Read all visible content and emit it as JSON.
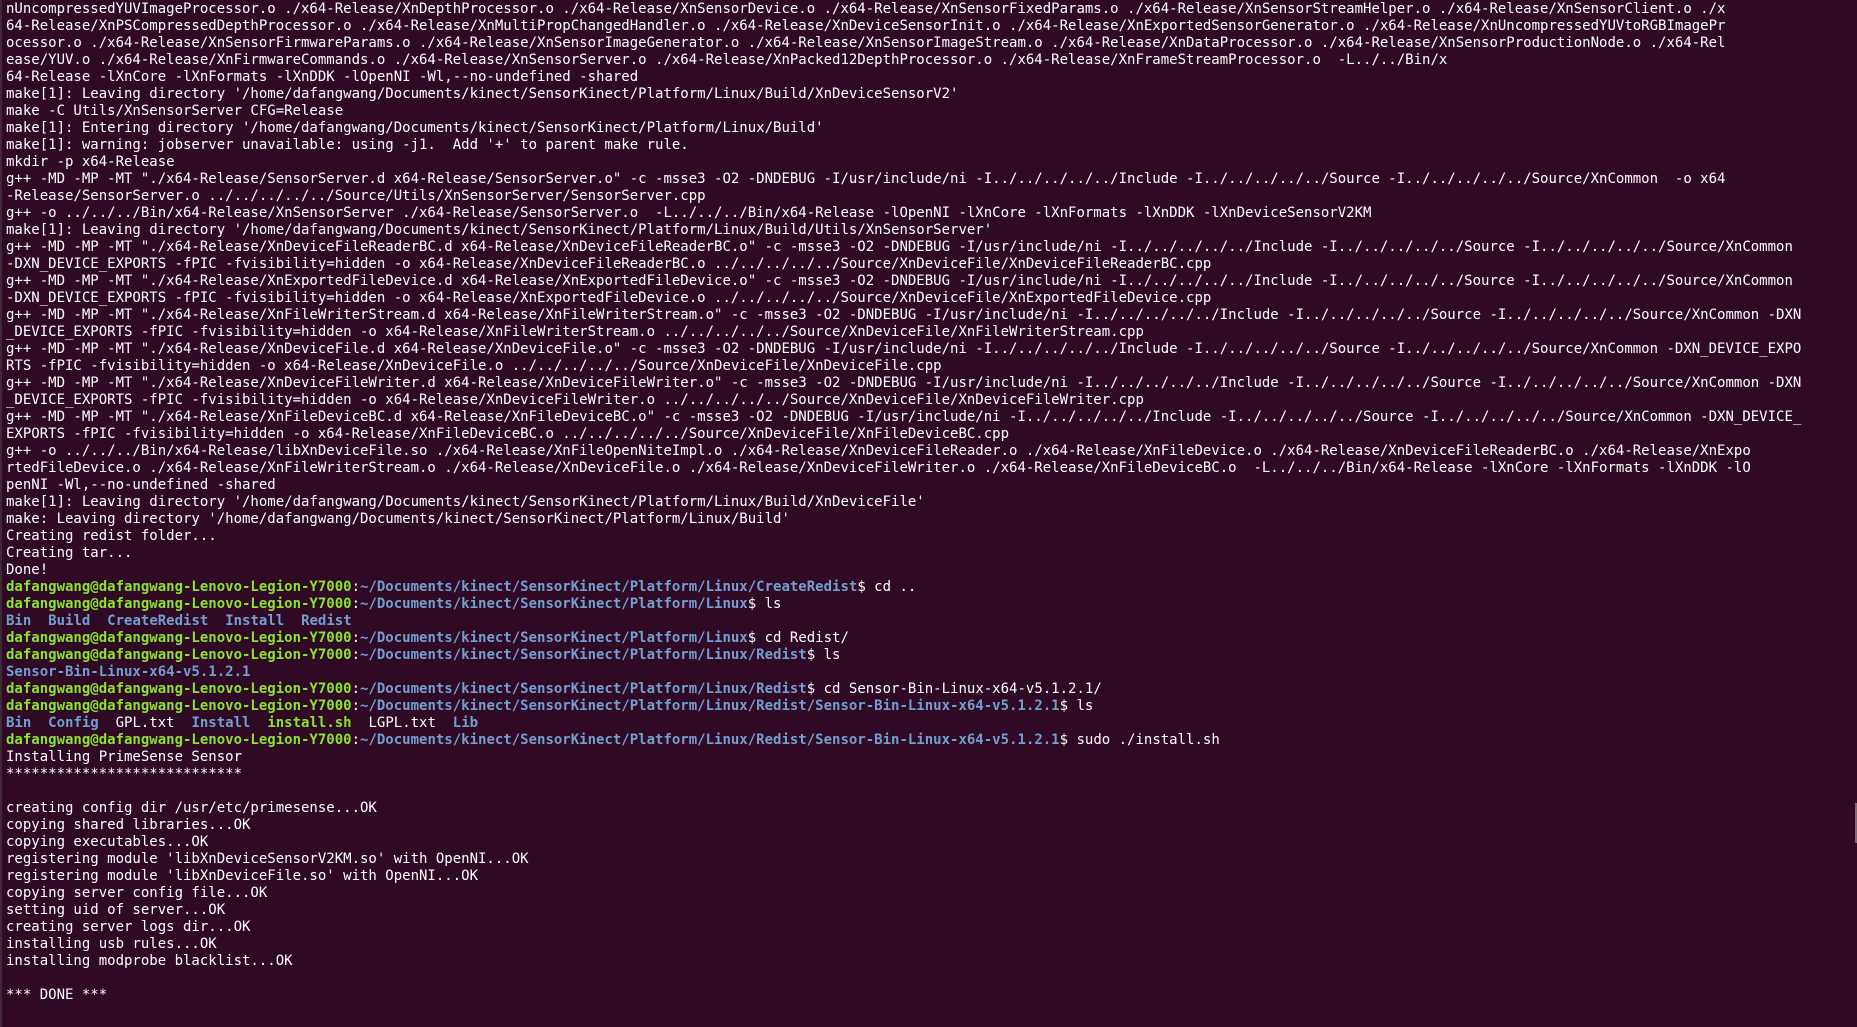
{
  "colors": {
    "background": "#300a24",
    "text": "#ffffff",
    "prompt_user": "#8ae234",
    "prompt_path": "#729fcf",
    "directory": "#729fcf",
    "executable": "#8ae234"
  },
  "terminal": {
    "lines": [
      [
        {
          "t": "plain",
          "text": "nUncompressedYUVImageProcessor.o ./x64-Release/XnDepthProcessor.o ./x64-Release/XnSensorDevice.o ./x64-Release/XnSensorFixedParams.o ./x64-Release/XnSensorStreamHelper.o ./x64-Release/XnSensorClient.o ./x"
        }
      ],
      [
        {
          "t": "plain",
          "text": "64-Release/XnPSCompressedDepthProcessor.o ./x64-Release/XnMultiPropChangedHandler.o ./x64-Release/XnDeviceSensorInit.o ./x64-Release/XnExportedSensorGenerator.o ./x64-Release/XnUncompressedYUVtoRGBImagePr"
        }
      ],
      [
        {
          "t": "plain",
          "text": "ocessor.o ./x64-Release/XnSensorFirmwareParams.o ./x64-Release/XnSensorImageGenerator.o ./x64-Release/XnSensorImageStream.o ./x64-Release/XnDataProcessor.o ./x64-Release/XnSensorProductionNode.o ./x64-Rel"
        }
      ],
      [
        {
          "t": "plain",
          "text": "ease/YUV.o ./x64-Release/XnFirmwareCommands.o ./x64-Release/XnSensorServer.o ./x64-Release/XnPacked12DepthProcessor.o ./x64-Release/XnFrameStreamProcessor.o  -L../../Bin/x"
        }
      ],
      [
        {
          "t": "plain",
          "text": "64-Release -lXnCore -lXnFormats -lXnDDK -lOpenNI -Wl,--no-undefined -shared"
        }
      ],
      [
        {
          "t": "plain",
          "text": "make[1]: Leaving directory '/home/dafangwang/Documents/kinect/SensorKinect/Platform/Linux/Build/XnDeviceSensorV2'"
        }
      ],
      [
        {
          "t": "plain",
          "text": "make -C Utils/XnSensorServer CFG=Release"
        }
      ],
      [
        {
          "t": "plain",
          "text": "make[1]: Entering directory '/home/dafangwang/Documents/kinect/SensorKinect/Platform/Linux/Build'"
        }
      ],
      [
        {
          "t": "plain",
          "text": "make[1]: warning: jobserver unavailable: using -j1.  Add '+' to parent make rule."
        }
      ],
      [
        {
          "t": "plain",
          "text": "mkdir -p x64-Release"
        }
      ],
      [
        {
          "t": "plain",
          "text": "g++ -MD -MP -MT \"./x64-Release/SensorServer.d x64-Release/SensorServer.o\" -c -msse3 -O2 -DNDEBUG -I/usr/include/ni -I../../../../../Include -I../../../../../Source -I../../../../../Source/XnCommon  -o x64"
        }
      ],
      [
        {
          "t": "plain",
          "text": "-Release/SensorServer.o ../../../../../Source/Utils/XnSensorServer/SensorServer.cpp"
        }
      ],
      [
        {
          "t": "plain",
          "text": "g++ -o ../../../Bin/x64-Release/XnSensorServer ./x64-Release/SensorServer.o  -L../../../Bin/x64-Release -lOpenNI -lXnCore -lXnFormats -lXnDDK -lXnDeviceSensorV2KM"
        }
      ],
      [
        {
          "t": "plain",
          "text": "make[1]: Leaving directory '/home/dafangwang/Documents/kinect/SensorKinect/Platform/Linux/Build/Utils/XnSensorServer'"
        }
      ],
      [
        {
          "t": "plain",
          "text": "g++ -MD -MP -MT \"./x64-Release/XnDeviceFileReaderBC.d x64-Release/XnDeviceFileReaderBC.o\" -c -msse3 -O2 -DNDEBUG -I/usr/include/ni -I../../../../../Include -I../../../../../Source -I../../../../../Source/XnCommon"
        }
      ],
      [
        {
          "t": "plain",
          "text": "-DXN_DEVICE_EXPORTS -fPIC -fvisibility=hidden -o x64-Release/XnDeviceFileReaderBC.o ../../../../../Source/XnDeviceFile/XnDeviceFileReaderBC.cpp"
        }
      ],
      [
        {
          "t": "plain",
          "text": "g++ -MD -MP -MT \"./x64-Release/XnExportedFileDevice.d x64-Release/XnExportedFileDevice.o\" -c -msse3 -O2 -DNDEBUG -I/usr/include/ni -I../../../../../Include -I../../../../../Source -I../../../../../Source/XnCommon"
        }
      ],
      [
        {
          "t": "plain",
          "text": "-DXN_DEVICE_EXPORTS -fPIC -fvisibility=hidden -o x64-Release/XnExportedFileDevice.o ../../../../../Source/XnDeviceFile/XnExportedFileDevice.cpp"
        }
      ],
      [
        {
          "t": "plain",
          "text": "g++ -MD -MP -MT \"./x64-Release/XnFileWriterStream.d x64-Release/XnFileWriterStream.o\" -c -msse3 -O2 -DNDEBUG -I/usr/include/ni -I../../../../../Include -I../../../../../Source -I../../../../../Source/XnCommon -DXN"
        }
      ],
      [
        {
          "t": "plain",
          "text": "_DEVICE_EXPORTS -fPIC -fvisibility=hidden -o x64-Release/XnFileWriterStream.o ../../../../../Source/XnDeviceFile/XnFileWriterStream.cpp"
        }
      ],
      [
        {
          "t": "plain",
          "text": "g++ -MD -MP -MT \"./x64-Release/XnDeviceFile.d x64-Release/XnDeviceFile.o\" -c -msse3 -O2 -DNDEBUG -I/usr/include/ni -I../../../../../Include -I../../../../../Source -I../../../../../Source/XnCommon -DXN_DEVICE_EXPO"
        }
      ],
      [
        {
          "t": "plain",
          "text": "RTS -fPIC -fvisibility=hidden -o x64-Release/XnDeviceFile.o ../../../../../Source/XnDeviceFile/XnDeviceFile.cpp"
        }
      ],
      [
        {
          "t": "plain",
          "text": "g++ -MD -MP -MT \"./x64-Release/XnDeviceFileWriter.d x64-Release/XnDeviceFileWriter.o\" -c -msse3 -O2 -DNDEBUG -I/usr/include/ni -I../../../../../Include -I../../../../../Source -I../../../../../Source/XnCommon -DXN"
        }
      ],
      [
        {
          "t": "plain",
          "text": "_DEVICE_EXPORTS -fPIC -fvisibility=hidden -o x64-Release/XnDeviceFileWriter.o ../../../../../Source/XnDeviceFile/XnDeviceFileWriter.cpp"
        }
      ],
      [
        {
          "t": "plain",
          "text": "g++ -MD -MP -MT \"./x64-Release/XnFileDeviceBC.d x64-Release/XnFileDeviceBC.o\" -c -msse3 -O2 -DNDEBUG -I/usr/include/ni -I../../../../../Include -I../../../../../Source -I../../../../../Source/XnCommon -DXN_DEVICE_"
        }
      ],
      [
        {
          "t": "plain",
          "text": "EXPORTS -fPIC -fvisibility=hidden -o x64-Release/XnFileDeviceBC.o ../../../../../Source/XnDeviceFile/XnFileDeviceBC.cpp"
        }
      ],
      [
        {
          "t": "plain",
          "text": "g++ -o ../../../Bin/x64-Release/libXnDeviceFile.so ./x64-Release/XnFileOpenNiteImpl.o ./x64-Release/XnDeviceFileReader.o ./x64-Release/XnFileDevice.o ./x64-Release/XnDeviceFileReaderBC.o ./x64-Release/XnExpo"
        }
      ],
      [
        {
          "t": "plain",
          "text": "rtedFileDevice.o ./x64-Release/XnFileWriterStream.o ./x64-Release/XnDeviceFile.o ./x64-Release/XnDeviceFileWriter.o ./x64-Release/XnFileDeviceBC.o  -L../../../Bin/x64-Release -lXnCore -lXnFormats -lXnDDK -lO"
        }
      ],
      [
        {
          "t": "plain",
          "text": "penNI -Wl,--no-undefined -shared"
        }
      ],
      [
        {
          "t": "plain",
          "text": "make[1]: Leaving directory '/home/dafangwang/Documents/kinect/SensorKinect/Platform/Linux/Build/XnDeviceFile'"
        }
      ],
      [
        {
          "t": "plain",
          "text": "make: Leaving directory '/home/dafangwang/Documents/kinect/SensorKinect/Platform/Linux/Build'"
        }
      ],
      [
        {
          "t": "plain",
          "text": "Creating redist folder..."
        }
      ],
      [
        {
          "t": "plain",
          "text": "Creating tar..."
        }
      ],
      [
        {
          "t": "plain",
          "text": "Done!"
        }
      ],
      [
        {
          "t": "user",
          "text": "dafangwang@dafangwang-Lenovo-Legion-Y7000"
        },
        {
          "t": "plain",
          "text": ":"
        },
        {
          "t": "path",
          "text": "~/Documents/kinect/SensorKinect/Platform/Linux/CreateRedist"
        },
        {
          "t": "plain",
          "text": "$ cd .."
        }
      ],
      [
        {
          "t": "user",
          "text": "dafangwang@dafangwang-Lenovo-Legion-Y7000"
        },
        {
          "t": "plain",
          "text": ":"
        },
        {
          "t": "path",
          "text": "~/Documents/kinect/SensorKinect/Platform/Linux"
        },
        {
          "t": "plain",
          "text": "$ ls"
        }
      ],
      [
        {
          "t": "dir",
          "text": "Bin"
        },
        {
          "t": "plain",
          "text": "  "
        },
        {
          "t": "dir",
          "text": "Build"
        },
        {
          "t": "plain",
          "text": "  "
        },
        {
          "t": "dir",
          "text": "CreateRedist"
        },
        {
          "t": "plain",
          "text": "  "
        },
        {
          "t": "dir",
          "text": "Install"
        },
        {
          "t": "plain",
          "text": "  "
        },
        {
          "t": "dir",
          "text": "Redist"
        }
      ],
      [
        {
          "t": "user",
          "text": "dafangwang@dafangwang-Lenovo-Legion-Y7000"
        },
        {
          "t": "plain",
          "text": ":"
        },
        {
          "t": "path",
          "text": "~/Documents/kinect/SensorKinect/Platform/Linux"
        },
        {
          "t": "plain",
          "text": "$ cd Redist/"
        }
      ],
      [
        {
          "t": "user",
          "text": "dafangwang@dafangwang-Lenovo-Legion-Y7000"
        },
        {
          "t": "plain",
          "text": ":"
        },
        {
          "t": "path",
          "text": "~/Documents/kinect/SensorKinect/Platform/Linux/Redist"
        },
        {
          "t": "plain",
          "text": "$ ls"
        }
      ],
      [
        {
          "t": "dir",
          "text": "Sensor-Bin-Linux-x64-v5.1.2.1"
        }
      ],
      [
        {
          "t": "user",
          "text": "dafangwang@dafangwang-Lenovo-Legion-Y7000"
        },
        {
          "t": "plain",
          "text": ":"
        },
        {
          "t": "path",
          "text": "~/Documents/kinect/SensorKinect/Platform/Linux/Redist"
        },
        {
          "t": "plain",
          "text": "$ cd Sensor-Bin-Linux-x64-v5.1.2.1/"
        }
      ],
      [
        {
          "t": "user",
          "text": "dafangwang@dafangwang-Lenovo-Legion-Y7000"
        },
        {
          "t": "plain",
          "text": ":"
        },
        {
          "t": "path",
          "text": "~/Documents/kinect/SensorKinect/Platform/Linux/Redist/Sensor-Bin-Linux-x64-v5.1.2.1"
        },
        {
          "t": "plain",
          "text": "$ ls"
        }
      ],
      [
        {
          "t": "dir",
          "text": "Bin"
        },
        {
          "t": "plain",
          "text": "  "
        },
        {
          "t": "dir",
          "text": "Config"
        },
        {
          "t": "plain",
          "text": "  GPL.txt  "
        },
        {
          "t": "dir",
          "text": "Install"
        },
        {
          "t": "plain",
          "text": "  "
        },
        {
          "t": "exec",
          "text": "install.sh"
        },
        {
          "t": "plain",
          "text": "  LGPL.txt  "
        },
        {
          "t": "dir",
          "text": "Lib"
        }
      ],
      [
        {
          "t": "user",
          "text": "dafangwang@dafangwang-Lenovo-Legion-Y7000"
        },
        {
          "t": "plain",
          "text": ":"
        },
        {
          "t": "path",
          "text": "~/Documents/kinect/SensorKinect/Platform/Linux/Redist/Sensor-Bin-Linux-x64-v5.1.2.1"
        },
        {
          "t": "plain",
          "text": "$ sudo ./install.sh"
        }
      ],
      [
        {
          "t": "plain",
          "text": "Installing PrimeSense Sensor"
        }
      ],
      [
        {
          "t": "plain",
          "text": "****************************"
        }
      ],
      [
        {
          "t": "plain",
          "text": ""
        }
      ],
      [
        {
          "t": "plain",
          "text": "creating config dir /usr/etc/primesense...OK"
        }
      ],
      [
        {
          "t": "plain",
          "text": "copying shared libraries...OK"
        }
      ],
      [
        {
          "t": "plain",
          "text": "copying executables...OK"
        }
      ],
      [
        {
          "t": "plain",
          "text": "registering module 'libXnDeviceSensorV2KM.so' with OpenNI...OK"
        }
      ],
      [
        {
          "t": "plain",
          "text": "registering module 'libXnDeviceFile.so' with OpenNI...OK"
        }
      ],
      [
        {
          "t": "plain",
          "text": "copying server config file...OK"
        }
      ],
      [
        {
          "t": "plain",
          "text": "setting uid of server...OK"
        }
      ],
      [
        {
          "t": "plain",
          "text": "creating server logs dir...OK"
        }
      ],
      [
        {
          "t": "plain",
          "text": "installing usb rules...OK"
        }
      ],
      [
        {
          "t": "plain",
          "text": "installing modprobe blacklist...OK"
        }
      ],
      [
        {
          "t": "plain",
          "text": ""
        }
      ],
      [
        {
          "t": "plain",
          "text": "*** DONE ***"
        }
      ]
    ]
  }
}
